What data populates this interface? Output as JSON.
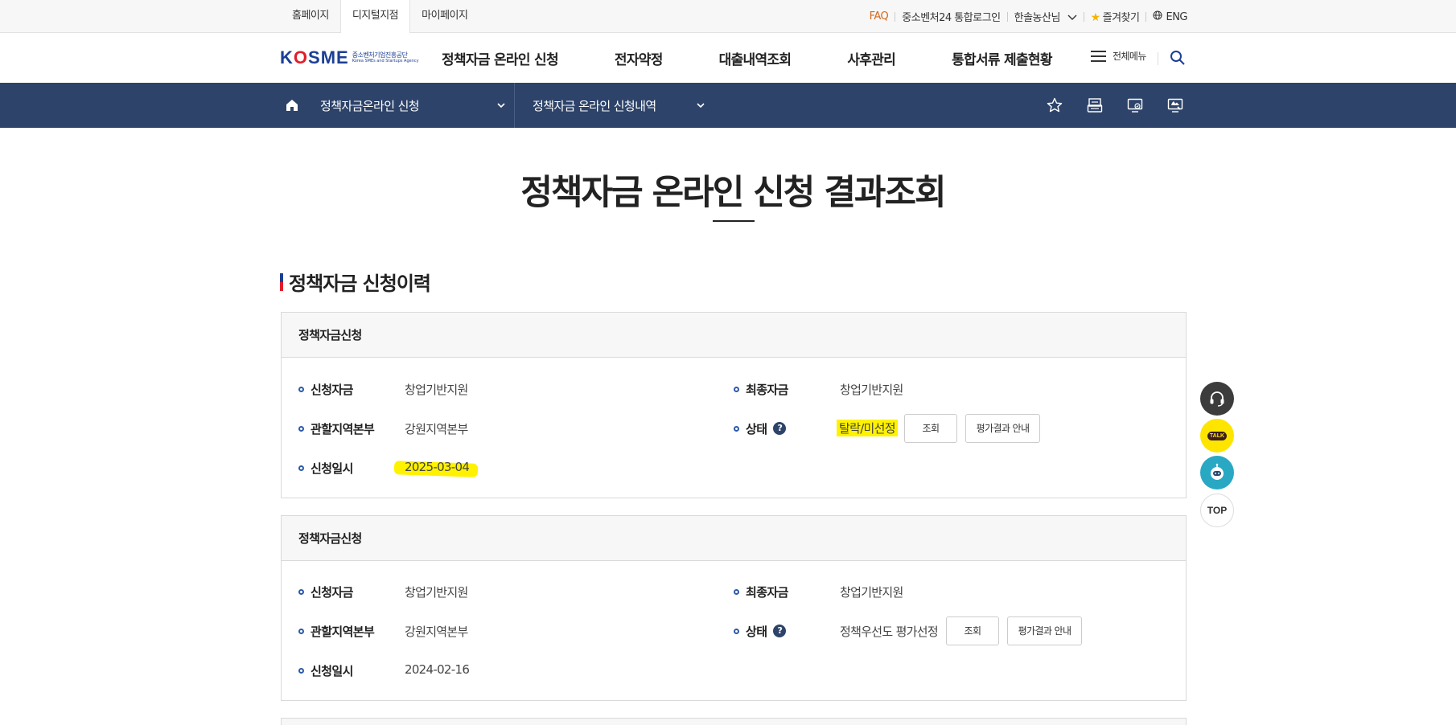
{
  "utilbar": {
    "tabs": [
      "홈페이지",
      "디지털지점",
      "마이페이지"
    ],
    "active_tab": "디지털지점",
    "faq": "FAQ",
    "login": "중소벤처24 통합로그인",
    "user": "한솔농산님",
    "favorites": "즐겨찾기",
    "lang": "ENG"
  },
  "header": {
    "logo_ko": "중소벤처기업진흥공단",
    "logo_en": "Korea SMEs and Startups Agency",
    "menu": [
      "정책자금 온라인 신청",
      "전자약정",
      "대출내역조회",
      "사후관리",
      "통합서류 제출현황"
    ],
    "all_menu": "전체메뉴"
  },
  "subnav": {
    "select1": "정책자금온라인 신청",
    "select2": "정책자금 온라인 신청내역"
  },
  "page_title": "정책자금 온라인 신청 결과조회",
  "section_title": "정책자금 신청이력",
  "records": [
    {
      "header": "정책자금신청",
      "label_apply_fund": "신청자금",
      "apply_fund": "창업기반지원",
      "label_final_fund": "최종자금",
      "final_fund": "창업기반지원",
      "label_region": "관할지역본부",
      "region": "강원지역본부",
      "label_status": "상태",
      "status": "탈락/미선정",
      "label_date": "신청일시",
      "date": "2025-03-04",
      "btn_view": "조회",
      "btn_guide": "평가결과 안내"
    },
    {
      "header": "정책자금신청",
      "label_apply_fund": "신청자금",
      "apply_fund": "창업기반지원",
      "label_final_fund": "최종자금",
      "final_fund": "창업기반지원",
      "label_region": "관할지역본부",
      "region": "강원지역본부",
      "label_status": "상태",
      "status": "정책우선도 평가선정",
      "label_date": "신청일시",
      "date": "2024-02-16",
      "btn_view": "조회",
      "btn_guide": "평가결과 안내"
    }
  ],
  "quick": {
    "talk": "TALK",
    "top": "TOP"
  },
  "colors": {
    "nav_bg": "#2d4369",
    "brand_blue": "#1b3f95",
    "brand_red": "#e31d2b",
    "highlight": "#fff200"
  }
}
